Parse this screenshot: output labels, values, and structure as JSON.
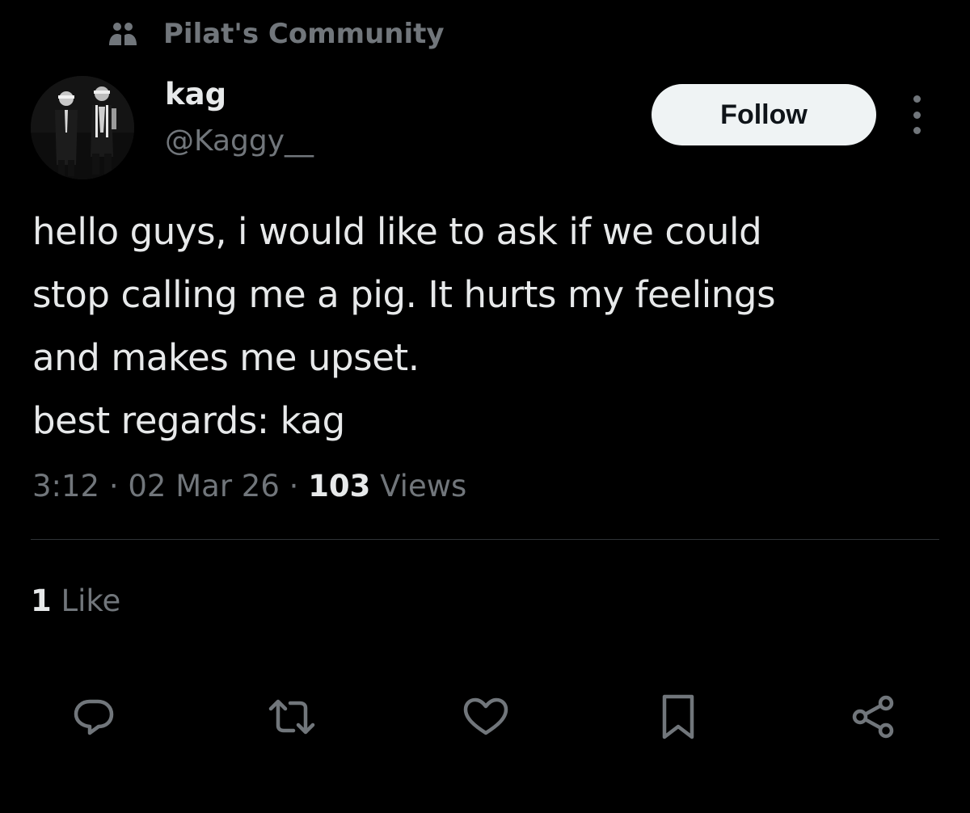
{
  "community": {
    "icon": "community-people-icon",
    "name": "Pilat's Community"
  },
  "author": {
    "avatar": "avatar-image",
    "display_name": "kag",
    "handle": "@Kaggy__",
    "follow_label": "Follow",
    "more_icon": "more-options-icon"
  },
  "tweet": {
    "text": "hello guys, i would like to ask if we could\nstop calling me a pig. It hurts my feelings\nand makes me upset.\nbest regards: kag",
    "time": "3:12",
    "sep1": " · ",
    "date": "02 Mar 26",
    "sep2": " · ",
    "views_count": "103",
    "views_label": " Views"
  },
  "stats": {
    "likes_count": "1",
    "likes_label": " Like"
  },
  "actions": [
    {
      "icon": "reply-icon"
    },
    {
      "icon": "retweet-icon"
    },
    {
      "icon": "like-heart-icon"
    },
    {
      "icon": "bookmark-icon"
    },
    {
      "icon": "share-icon"
    }
  ],
  "colors": {
    "background": "#000000",
    "text_primary": "#e7e9ea",
    "text_secondary": "#71767b",
    "button_bg": "#eff3f4",
    "divider": "#2f3336"
  }
}
